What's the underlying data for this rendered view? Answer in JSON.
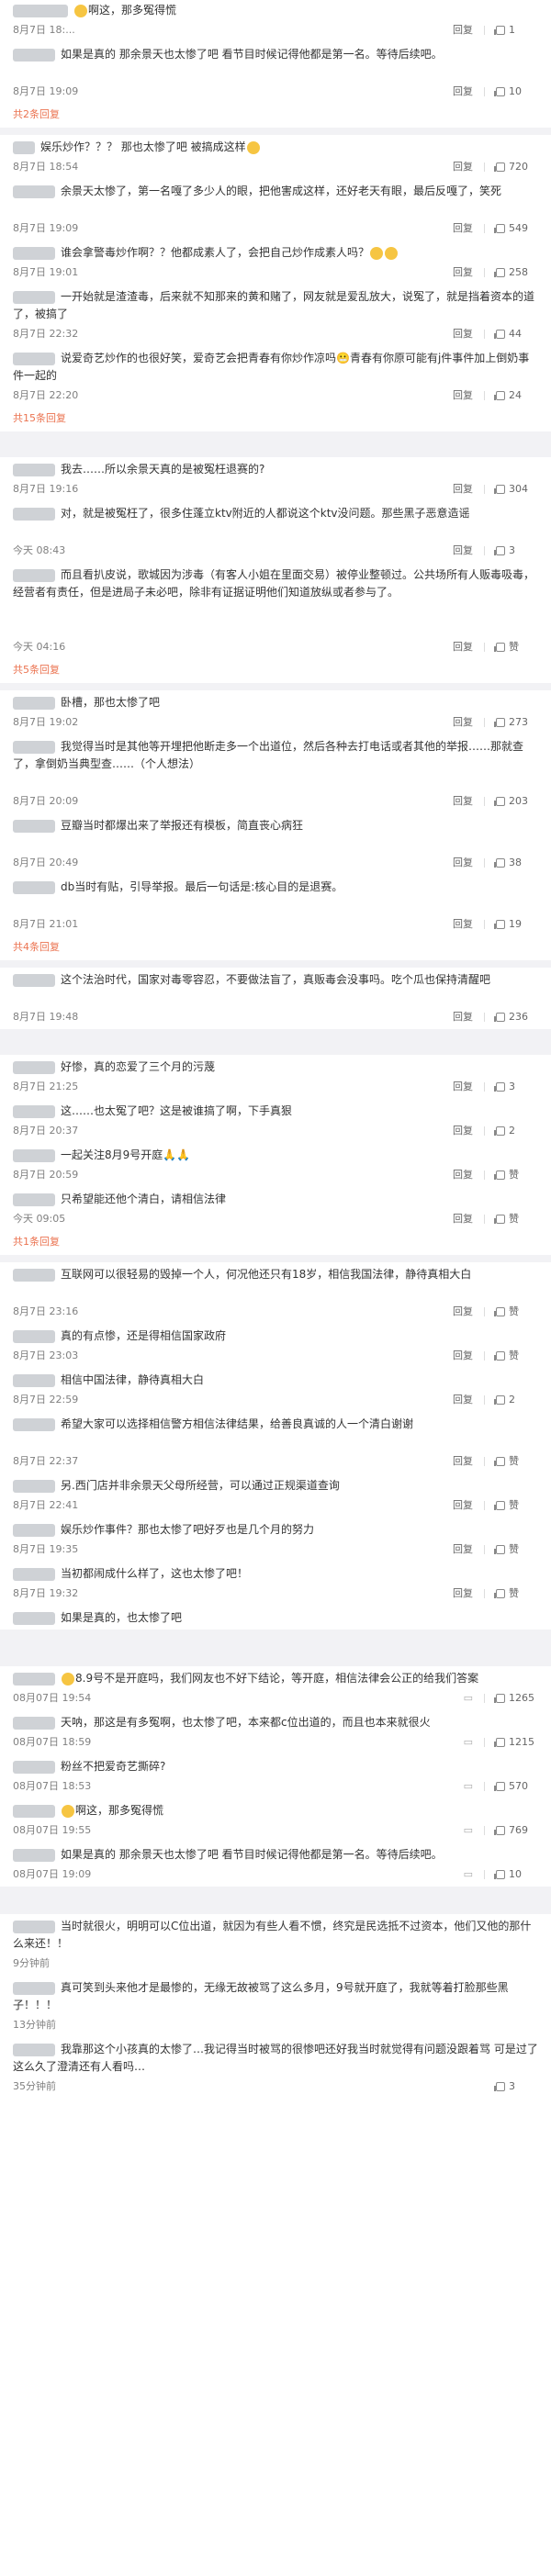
{
  "sections": [
    {
      "comments": [
        {
          "text": "啊这，那多冤得慌",
          "time": "8月7日 18:...",
          "likes": "1",
          "emoji": true
        },
        {
          "text": "如果是真的 那余景天也太惨了吧 看节目时候记得他都是第一名。等待后续吧。",
          "time": "8月7日 19:09",
          "likes": "10"
        }
      ],
      "more": "共2条回复"
    },
    {
      "comments": [
        {
          "text": "娱乐炒作？？？ 那也太惨了吧 被搞成这样",
          "time": "8月7日 18:54",
          "likes": "720",
          "emoji": true
        },
        {
          "text": "余景天太惨了，第一名嘎了多少人的眼，把他害成这样，还好老天有眼，最后反嘎了，笑死",
          "time": "8月7日 19:09",
          "likes": "549"
        },
        {
          "text": "谁会拿警毒炒作啊？？他都成素人了，会把自己炒作成素人吗？",
          "time": "8月7日 19:01",
          "likes": "258",
          "emoji": true
        },
        {
          "text": "一开始就是渣渣毒，后来就不知那来的黄和赌了，网友就是爱乱放大，说冤了，就是挡着资本的道了，被搞了",
          "time": "8月7日 22:32",
          "likes": "44"
        },
        {
          "text": "说爱奇艺炒作的也很好笑，爱奇艺会把青春有你炒作凉吗😬青春有你原可能有j件事件加上倒奶事件一起的",
          "time": "8月7日 22:20",
          "likes": "24"
        }
      ],
      "more": "共15条回复"
    },
    {
      "comments": [
        {
          "text": "我去……所以余景天真的是被冤枉退赛的?",
          "time": "8月7日 19:16",
          "likes": "304"
        },
        {
          "text": "对，就是被冤枉了，很多住蓬立ktv附近的人都说这个ktv没问题。那些黑子恶意造谣",
          "time": "今天 08:43",
          "likes": "3"
        },
        {
          "text": "而且看扒皮说，歌城因为涉毒（有客人小姐在里面交易）被停业整顿过。公共场所有人贩毒吸毒，经营者有责任，但是进局子未必吧，除非有证据证明他们知道放纵或者参与了。",
          "time": "今天 04:16",
          "likes": "赞"
        }
      ],
      "more": "共5条回复"
    },
    {
      "comments": [
        {
          "text": "卧槽，那也太惨了吧",
          "time": "8月7日 19:02",
          "likes": "273"
        },
        {
          "text": "我觉得当时是其他等开埋把他断走多一个出道位，然后各种去打电话或者其他的举报……那就查了，拿倒奶当典型查……（个人想法）",
          "time": "8月7日 20:09",
          "likes": "203"
        },
        {
          "text": "豆瓣当时都爆出来了举报还有模板，简直丧心病狂",
          "time": "8月7日 20:49",
          "likes": "38"
        },
        {
          "text": "db当时有贴，引导举报。最后一句话是:核心目的是退赛。",
          "time": "8月7日 21:01",
          "likes": "19"
        }
      ],
      "more": "共4条回复"
    },
    {
      "comments": [
        {
          "text": "这个法治时代，国家对毒零容忍，不要做法盲了，真贩毒会没事吗。吃个瓜也保持清醒吧",
          "time": "8月7日 19:48",
          "likes": "236"
        }
      ],
      "more": ""
    },
    {
      "comments": [
        {
          "text": "好惨，真的恋爱了三个月的污蔑",
          "time": "8月7日 21:25",
          "likes": "3"
        },
        {
          "text": "这……也太冤了吧？这是被谁搞了啊，下手真狠",
          "time": "8月7日 20:37",
          "likes": "2"
        },
        {
          "text": "一起关注8月9号开庭🙏🙏",
          "time": "8月7日 20:59",
          "likes": "赞"
        },
        {
          "text": "只希望能还他个清白，请相信法律",
          "time": "今天 09:05",
          "likes": "赞"
        }
      ],
      "more": "共1条回复"
    },
    {
      "comments": [
        {
          "text": "互联网可以很轻易的毁掉一个人，何况他还只有18岁，相信我国法律，静待真相大白",
          "time": "8月7日 23:16",
          "likes": "赞"
        },
        {
          "text": "真的有点惨，还是得相信国家政府",
          "time": "8月7日 23:03",
          "likes": "赞"
        },
        {
          "text": "相信中国法律，静待真相大白",
          "time": "8月7日 22:59",
          "likes": "2"
        },
        {
          "text": "希望大家可以选择相信警方相信法律结果，给善良真诚的人一个清白谢谢",
          "time": "8月7日 22:37",
          "likes": "赞"
        },
        {
          "text": "另.西门店并非余景天父母所经营，可以通过正规渠道查询",
          "time": "8月7日 22:41",
          "likes": "赞"
        },
        {
          "text": "娱乐炒作事件？那也太惨了吧好歹也是几个月的努力",
          "time": "8月7日 19:35",
          "likes": "赞"
        },
        {
          "text": "当初都闹成什么样了，这也太惨了吧！",
          "time": "8月7日 19:32",
          "likes": "赞"
        },
        {
          "text": "如果是真的，也太惨了吧",
          "time": "",
          "likes": ""
        }
      ],
      "more": ""
    },
    {
      "comments": [
        {
          "text": "8.9号不是开庭吗，我们网友也不好下结论，等开庭，相信法律会公正的给我们答案",
          "time": "08月07日 19:54",
          "likes": "1265"
        },
        {
          "text": "天呐，那这是有多冤啊，也太惨了吧，本来都c位出道的，而且也本来就很火",
          "time": "08月07日 18:59",
          "likes": "1215"
        },
        {
          "text": "粉丝不把爱奇艺撕碎?",
          "time": "08月07日 18:53",
          "likes": "570"
        },
        {
          "text": "啊这，那多冤得慌",
          "time": "08月07日 19:55",
          "likes": "769"
        },
        {
          "text": "如果是真的 那余景天也太惨了吧 看节目时候记得他都是第一名。等待后续吧。",
          "time": "08月07日 19:09",
          "likes": "10"
        }
      ],
      "more": ""
    },
    {
      "comments": [
        {
          "text": "当时就很火，明明可以C位出道，就因为有些人看不惯，终究是民选抵不过资本，他们又他的那什么来还！！",
          "time": "9分钟前",
          "likes": ""
        },
        {
          "text": "真可笑到头来他才是最惨的，无缘无故被骂了这么多月，9号就开庭了，我就等着打脸那些黑子！！！",
          "time": "13分钟前",
          "likes": ""
        },
        {
          "text": "我靠那这个小孩真的太惨了…我记得当时被骂的很惨吧还好我当时就觉得有问题没跟着骂 可是过了这么久了澄清还有人看吗…",
          "time": "35分钟前",
          "likes": "3"
        }
      ],
      "more": ""
    }
  ],
  "labels": {
    "reply": "回复",
    "like_word": "赞"
  }
}
